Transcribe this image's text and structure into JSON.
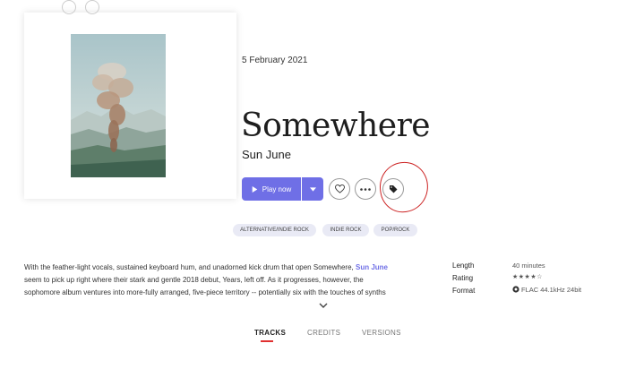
{
  "release_date": "5 February 2021",
  "album": {
    "title": "Somewhere",
    "artist": "Sun June"
  },
  "actions": {
    "play_label": "Play now",
    "play_icon": "play-icon",
    "dropdown_icon": "caret-down-icon",
    "favorite_icon": "heart-icon",
    "more_icon": "more-dots-icon",
    "tag_icon": "tag-icon"
  },
  "genres": [
    "ALTERNATIVE/INDIE ROCK",
    "INDIE ROCK",
    "POP/ROCK"
  ],
  "description": {
    "line1_before": "With the feather-light vocals, sustained keyboard hum, and unadorned kick drum that open Somewhere, ",
    "line1_link": "Sun June",
    "line2": "seem to pick up right where their stark and gentle 2018 debut, Years, left off. As it progresses, however, the",
    "line3": "sophomore album ventures into more-fully arranged, five-piece territory -- potentially six with the touches of synths"
  },
  "meta": {
    "length_label": "Length",
    "length_value": "40 minutes",
    "rating_label": "Rating",
    "rating_stars": "★★★★☆",
    "format_label": "Format",
    "format_value": "FLAC 44.1kHz 24bit"
  },
  "tabs": [
    {
      "label": "TRACKS",
      "active": true
    },
    {
      "label": "CREDITS",
      "active": false
    },
    {
      "label": "VERSIONS",
      "active": false
    }
  ],
  "colors": {
    "accent": "#6f6fe6",
    "tab_underline": "#e03030",
    "annotation": "#cc2222",
    "tag_bg": "#e9eaf5"
  }
}
